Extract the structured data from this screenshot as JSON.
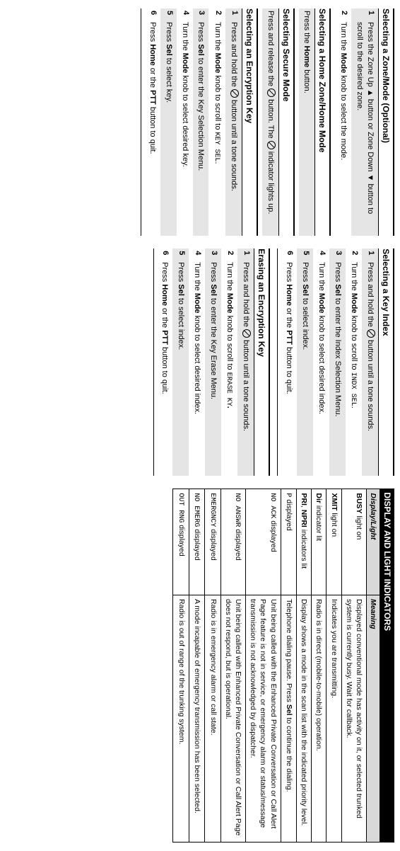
{
  "col1": {
    "s1": {
      "title": "Selecting a Zone/Mode (Optional)",
      "steps": [
        "Press the Zone Up ▲ button or Zone Down ▼ button to scroll to the desired zone.",
        "Turn the <b>Mode</b> knob to select the mode."
      ]
    },
    "s2": {
      "title": "Selecting a Home Zone/Home Mode",
      "single": "Press the <b>Home</b> button."
    },
    "s3": {
      "title": "Selecting Secure Mode",
      "single": "Press and release the {O} button. The {O} indicator lights up."
    },
    "s4": {
      "title": "Selecting an Encryption Key",
      "steps": [
        "Press and hold the {O} button until a tone sounds.",
        "Turn the <b>Mode</b> knob to scroll to <span class='mono'>KEY SEL</span>.",
        "Press <b>Sel</b> to enter the Key Selection Menu.",
        "Turn the <b>Mode</b> knob to select desired key.",
        "Press <b>Sel</b> to select key.",
        "Press <b>Home</b> or the <b>PTT</b> button to quit."
      ]
    }
  },
  "col2": {
    "s1": {
      "title": "Selecting a Key Index",
      "steps": [
        "Press and hold the {O} button until a tone sounds.",
        "Turn the <b>Mode</b> knob to scroll to <span class='mono'>INDX SEL</span>.",
        "Press <b>Sel</b> to enter the Index Selection Menu.",
        "Turn the <b>Mode</b> knob to select desired index.",
        "Press <b>Sel</b> to select index.",
        "Press <b>Home</b> or the <b>PTT</b> button to quit."
      ]
    },
    "s2": {
      "title": "Erasing an Encryption Key",
      "steps": [
        "Press and hold the {O} button until a tone sounds.",
        "Turn the <b>Mode</b> knob to scroll to <span class='mono'>ERASE KY</span><b>.</b>",
        "Press <b>Sel</b> to enter the Key Erase Menu.",
        "Turn the <b>Mode</b> knob to select desired index.",
        "Press <b>Sel</b> to select index.",
        "Press <b>Home</b> or the <b>PTT</b> button to quit."
      ]
    }
  },
  "col3": {
    "title": "DISPLAY AND LIGHT INDICATORS",
    "head1": "Display/Light",
    "head2": "Meaning",
    "rows": [
      [
        "<b>BUSY</b> light on",
        "Displayed conventional mode has activity on it, or selected trunked system is currently busy. Wait for callback."
      ],
      [
        "<b>XMIT</b> light on",
        "Indicates you are transmitting."
      ],
      [
        "<b>Dir</b> indicator lit",
        "Radio is in direct (mobile-to-mobile) operation."
      ],
      [
        "<b>PRI</b>, <b>NPRI</b> indicators lit",
        "Display shows a mode in the scan list with the indicated priority level."
      ],
      [
        "<span class='mono'>P</span> displayed",
        "Telephone dialing pause. Press <b>Sel</b> to continue the dialing."
      ],
      [
        "<span class='mono'>NO ACK</span> displayed",
        "Unit being called with the Enhanced Private Conversation or Call Alert Page feature is not in service, or emergency alarm or status/message transmission is not acknowledged by dispatcher."
      ],
      [
        "<span class='mono'>NO ANSWR</span> displayed",
        "Unit being called with Enhanced Private Conversation or Call Alert Page does not respond, but is operational."
      ],
      [
        "<span class='mono'>EMERGNCY</span> displayed",
        "Radio is in emergency alarm or call state."
      ],
      [
        "<span class='mono'>NO EMERG</span> displayed",
        "A mode incapable of emergency transmission has been selected."
      ],
      [
        "<span class='mono'>OUT RNG</span> displayed",
        "Radio is out of range of the trunking system."
      ]
    ]
  }
}
